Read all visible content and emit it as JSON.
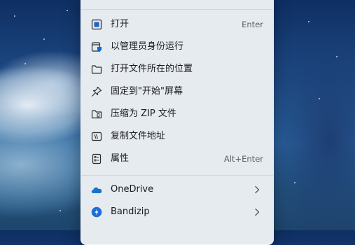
{
  "context_menu": {
    "items": [
      {
        "label": "打开",
        "shortcut": "Enter",
        "icon": "open-icon"
      },
      {
        "label": "以管理员身份运行",
        "shortcut": "",
        "icon": "shield-run-admin-icon"
      },
      {
        "label": "打开文件所在的位置",
        "shortcut": "",
        "icon": "folder-icon"
      },
      {
        "label": "固定到\"开始\"屏幕",
        "shortcut": "",
        "icon": "pin-icon"
      },
      {
        "label": "压缩为 ZIP 文件",
        "shortcut": "",
        "icon": "zip-folder-icon"
      },
      {
        "label": "复制文件地址",
        "shortcut": "",
        "icon": "copy-path-icon"
      },
      {
        "label": "属性",
        "shortcut": "Alt+Enter",
        "icon": "properties-icon"
      }
    ],
    "submenus": [
      {
        "label": "OneDrive",
        "icon": "onedrive-cloud-icon",
        "accent": "#1a73c9"
      },
      {
        "label": "Bandizip",
        "icon": "bandizip-icon",
        "accent": "#1f6fd1"
      }
    ]
  }
}
